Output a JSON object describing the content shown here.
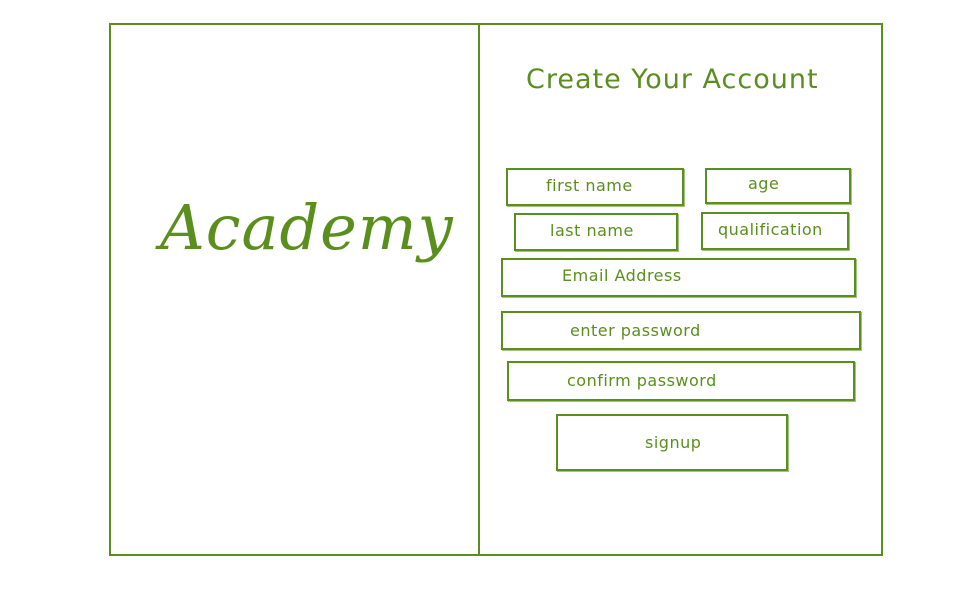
{
  "brand": {
    "name": "Academy"
  },
  "form": {
    "title": "Create Your Account",
    "fields": {
      "first_name": "first name",
      "age": "age",
      "last_name": "last name",
      "qualification": "qualification",
      "email": "Email Address",
      "password": "enter password",
      "confirm_password": "confirm password"
    },
    "submit_label": "signup"
  },
  "colors": {
    "stroke": "#5a8f1d",
    "background": "#ffffff"
  }
}
